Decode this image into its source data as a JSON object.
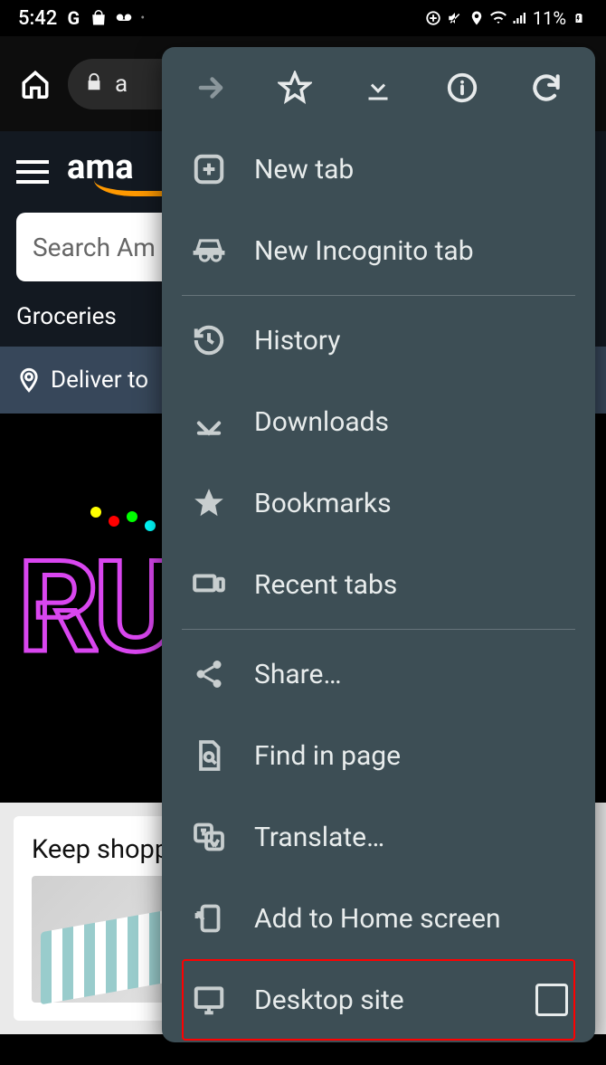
{
  "status_bar": {
    "time": "5:42",
    "battery_pct": "11%"
  },
  "browser": {
    "url_fragment": "a"
  },
  "amazon": {
    "logo_text": "ama",
    "search_placeholder": "Search Am",
    "nav_groceries": "Groceries",
    "deliver_to": "Deliver to",
    "hero_text": "RU",
    "card_title": "Keep shoppi"
  },
  "menu": {
    "items": [
      {
        "label": "New tab"
      },
      {
        "label": "New Incognito tab"
      },
      {
        "label": "History"
      },
      {
        "label": "Downloads"
      },
      {
        "label": "Bookmarks"
      },
      {
        "label": "Recent tabs"
      },
      {
        "label": "Share…"
      },
      {
        "label": "Find in page"
      },
      {
        "label": "Translate…"
      },
      {
        "label": "Add to Home screen"
      },
      {
        "label": "Desktop site"
      }
    ]
  }
}
